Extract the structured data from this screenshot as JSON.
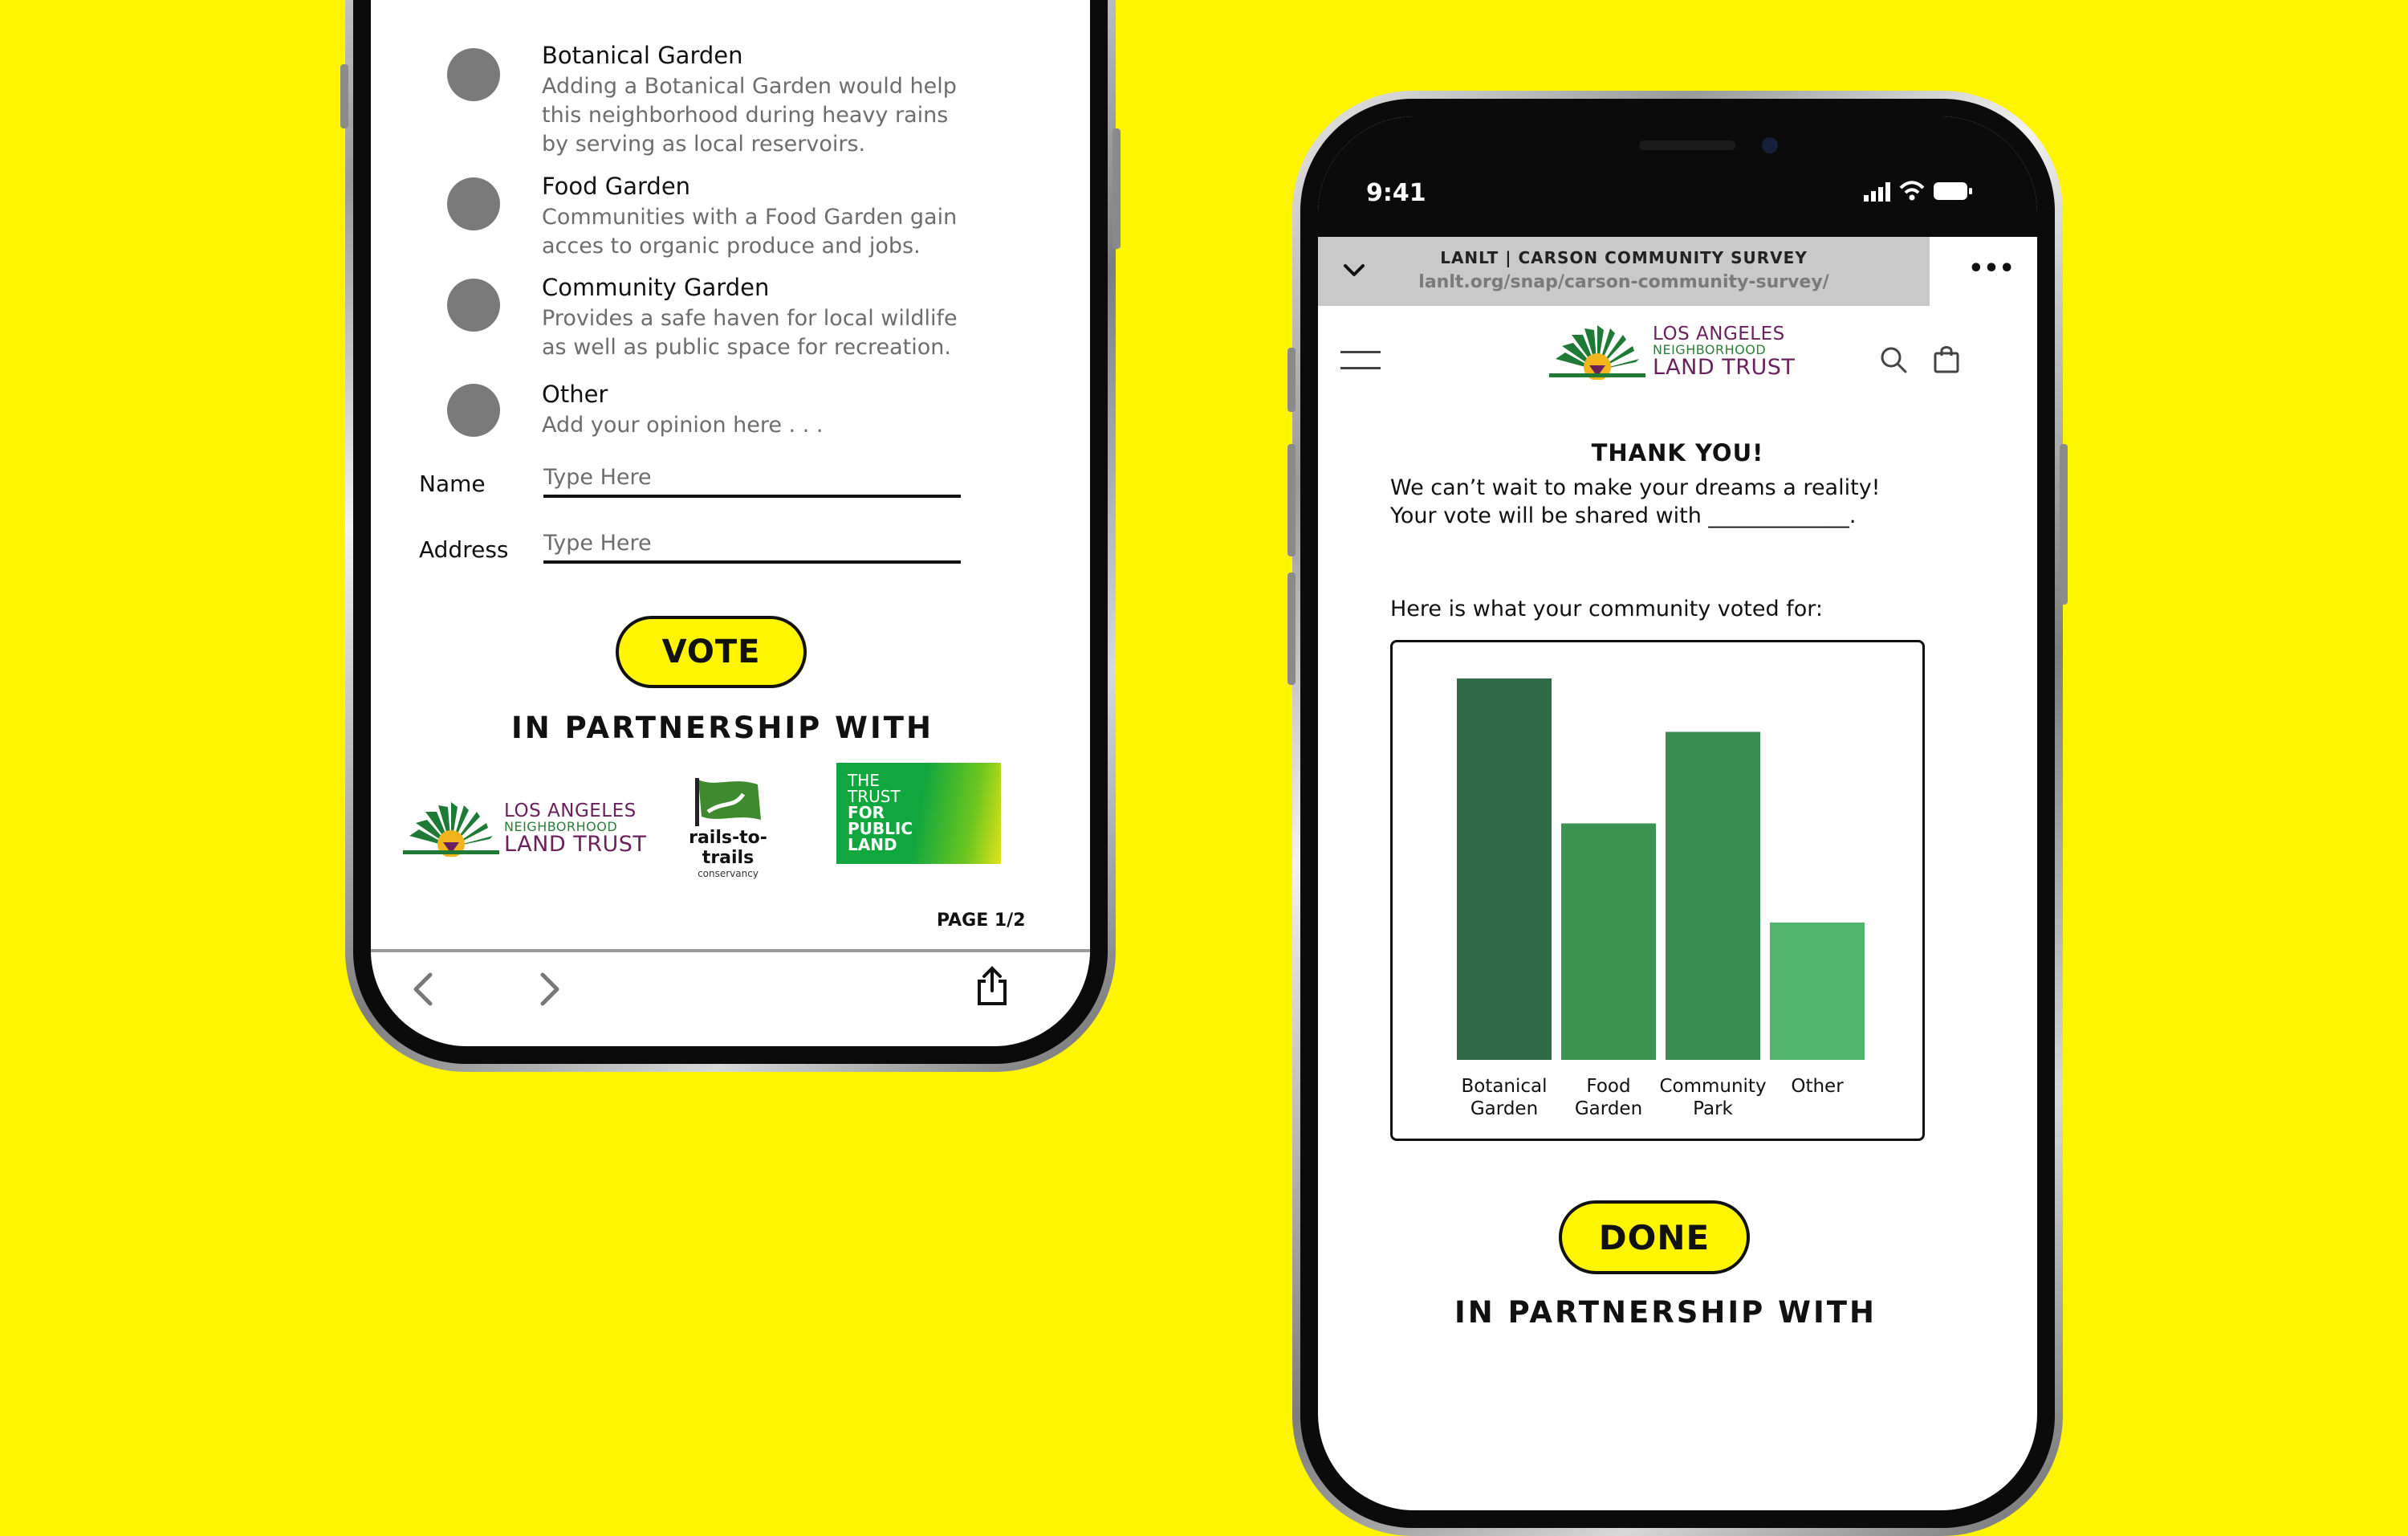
{
  "colors": {
    "background": "#FFF500",
    "button": "#FFF500",
    "radio": "#7a7a7a",
    "lanlt_purple": "#6b1f5c",
    "lanlt_green": "#2f7d3a"
  },
  "left_screen": {
    "options": [
      {
        "title": "Botanical Garden",
        "desc": [
          "Adding a Botanical Garden would help",
          "this neighborhood during heavy rains",
          "by serving as local reservoirs."
        ]
      },
      {
        "title": "Food Garden",
        "desc": [
          "Communities with a Food Garden gain",
          "acces to organic produce and jobs."
        ]
      },
      {
        "title": "Community Garden",
        "desc": [
          "Provides a safe haven for local wildlife",
          "as well as public space for recreation."
        ]
      },
      {
        "title": "Other",
        "desc": [
          "Add your opinion here . . ."
        ]
      }
    ],
    "form": {
      "name_label": "Name",
      "name_placeholder": "Type Here",
      "address_label": "Address",
      "address_placeholder": "Type Here"
    },
    "vote_button": "VOTE",
    "partner_heading": "IN PARTNERSHIP WITH",
    "partners": {
      "lanlt": {
        "line1": "LOS ANGELES",
        "line2": "NEIGHBORHOOD",
        "line3": "LAND TRUST"
      },
      "rails": {
        "name": "rails-to-trails",
        "sub": "conservancy"
      },
      "tpl": {
        "line1": "THE",
        "line2": "TRUST",
        "line3": "FOR",
        "line4": "PUBLIC",
        "line5": "LAND"
      }
    },
    "page_indicator": "PAGE 1/2",
    "toolbar_icons": [
      "chevron-left-icon",
      "chevron-right-icon",
      "share-icon"
    ]
  },
  "right_screen": {
    "status": {
      "time": "9:41"
    },
    "url_bar": {
      "title": "LANLT | CARSON COMMUNITY SURVEY",
      "url": "lanlt.org/snap/carson-community-survey/",
      "more": "•••"
    },
    "header": {
      "logo_line1": "LOS ANGELES",
      "logo_line2": "NEIGHBORHOOD",
      "logo_line3": "LAND TRUST"
    },
    "thank_title": "THANK YOU!",
    "thank_line1": "We can’t wait to make your dreams a reality!",
    "thank_line2": "Your vote will be shared with _____________.",
    "chart_intro": "Here is what your community voted for:",
    "done_button": "DONE",
    "partner_heading": "IN PARTNERSHIP WITH"
  },
  "chart_data": {
    "type": "bar",
    "categories": [
      "Botanical\nGarden",
      "Food\nGarden",
      "Community\nPark",
      "Other"
    ],
    "values": [
      100,
      62,
      86,
      36
    ],
    "colors": [
      "#2E6B46",
      "#3A9553",
      "#3A8A51",
      "#53B470"
    ],
    "title": "",
    "xlabel": "",
    "ylabel": "",
    "ylim": [
      0,
      100
    ],
    "grid": false
  }
}
